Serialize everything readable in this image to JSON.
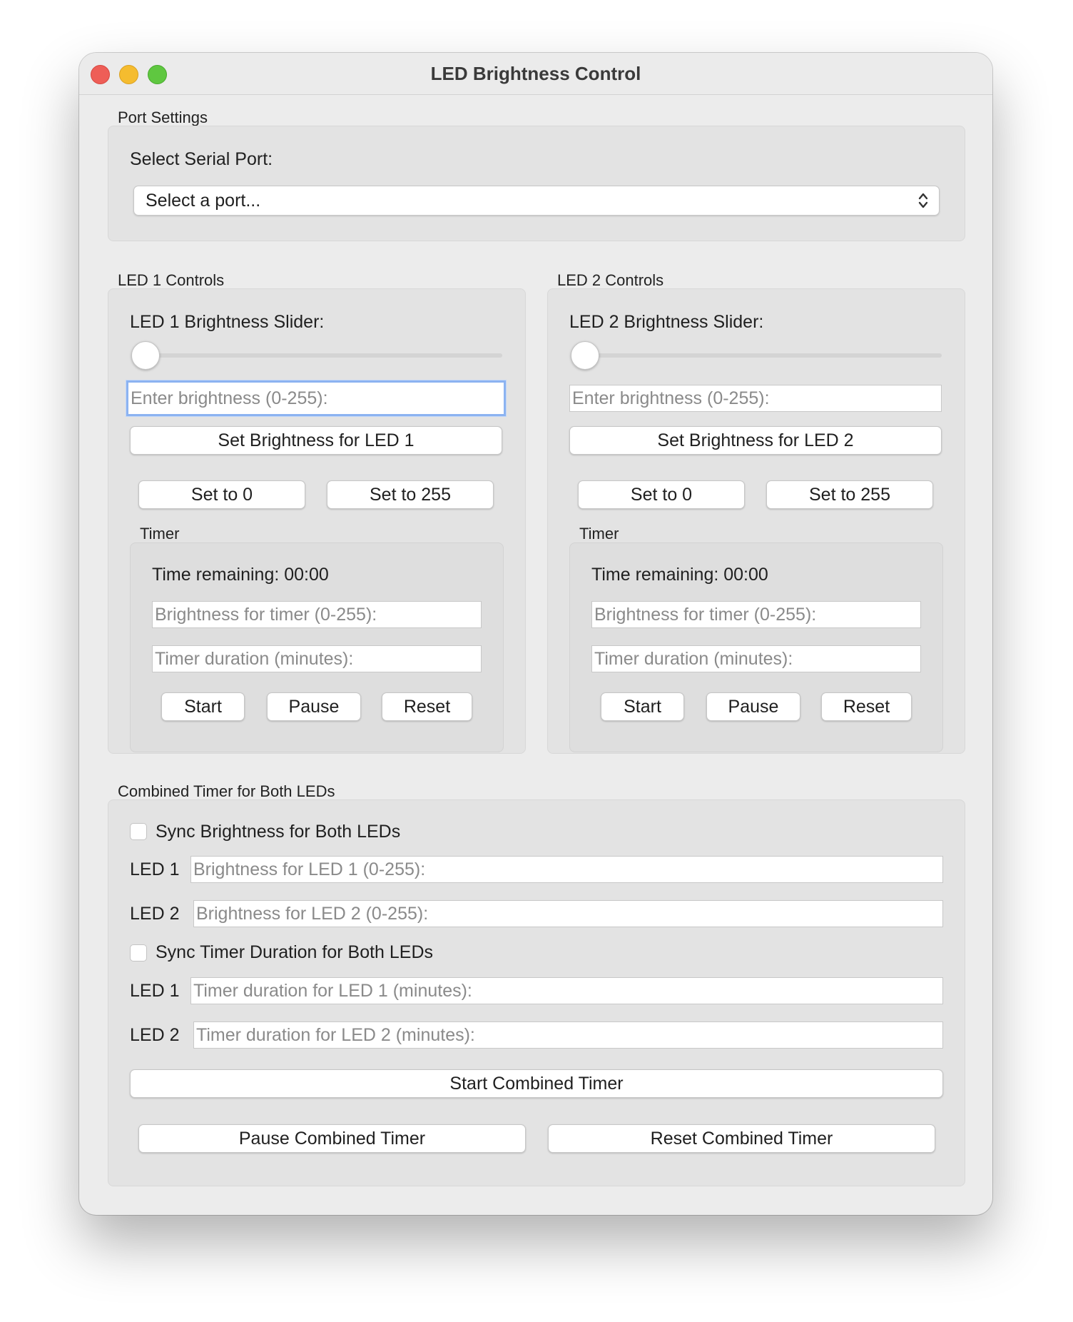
{
  "window": {
    "title": "LED Brightness Control"
  },
  "port_settings": {
    "group_label": "Port Settings",
    "select_label": "Select Serial Port:",
    "select_value": "Select a port..."
  },
  "led1": {
    "group_label": "LED 1 Controls",
    "slider_label": "LED 1 Brightness Slider:",
    "slider_value": 0,
    "brightness_placeholder": "Enter brightness (0-255):",
    "set_button": "Set Brightness for LED 1",
    "set0_button": "Set to 0",
    "set255_button": "Set to 255",
    "timer": {
      "group_label": "Timer",
      "time_remaining": "Time remaining: 00:00",
      "brightness_placeholder": "Brightness for timer (0-255):",
      "duration_placeholder": "Timer duration (minutes):",
      "start": "Start",
      "pause": "Pause",
      "reset": "Reset"
    }
  },
  "led2": {
    "group_label": "LED 2 Controls",
    "slider_label": "LED 2 Brightness Slider:",
    "slider_value": 0,
    "brightness_placeholder": "Enter brightness (0-255):",
    "set_button": "Set Brightness for LED 2",
    "set0_button": "Set to 0",
    "set255_button": "Set to 255",
    "timer": {
      "group_label": "Timer",
      "time_remaining": "Time remaining: 00:00",
      "brightness_placeholder": "Brightness for timer (0-255):",
      "duration_placeholder": "Timer duration (minutes):",
      "start": "Start",
      "pause": "Pause",
      "reset": "Reset"
    }
  },
  "combined": {
    "group_label": "Combined Timer for Both LEDs",
    "sync_brightness_label": "Sync Brightness for Both LEDs",
    "sync_brightness_checked": false,
    "led1_label": "LED 1",
    "led2_label": "LED 2",
    "led1_brightness_placeholder": "Brightness for LED 1 (0-255):",
    "led2_brightness_placeholder": "Brightness for LED 2 (0-255):",
    "sync_duration_label": "Sync Timer Duration for Both LEDs",
    "sync_duration_checked": false,
    "led1_duration_placeholder": "Timer duration for LED 1 (minutes):",
    "led2_duration_placeholder": "Timer duration for LED 2 (minutes):",
    "start_button": "Start Combined Timer",
    "pause_button": "Pause Combined Timer",
    "reset_button": "Reset Combined Timer"
  },
  "colors": {
    "focus_ring": "#8cb3f1",
    "window_bg": "#ececec",
    "group_bg": "#e3e3e3"
  }
}
